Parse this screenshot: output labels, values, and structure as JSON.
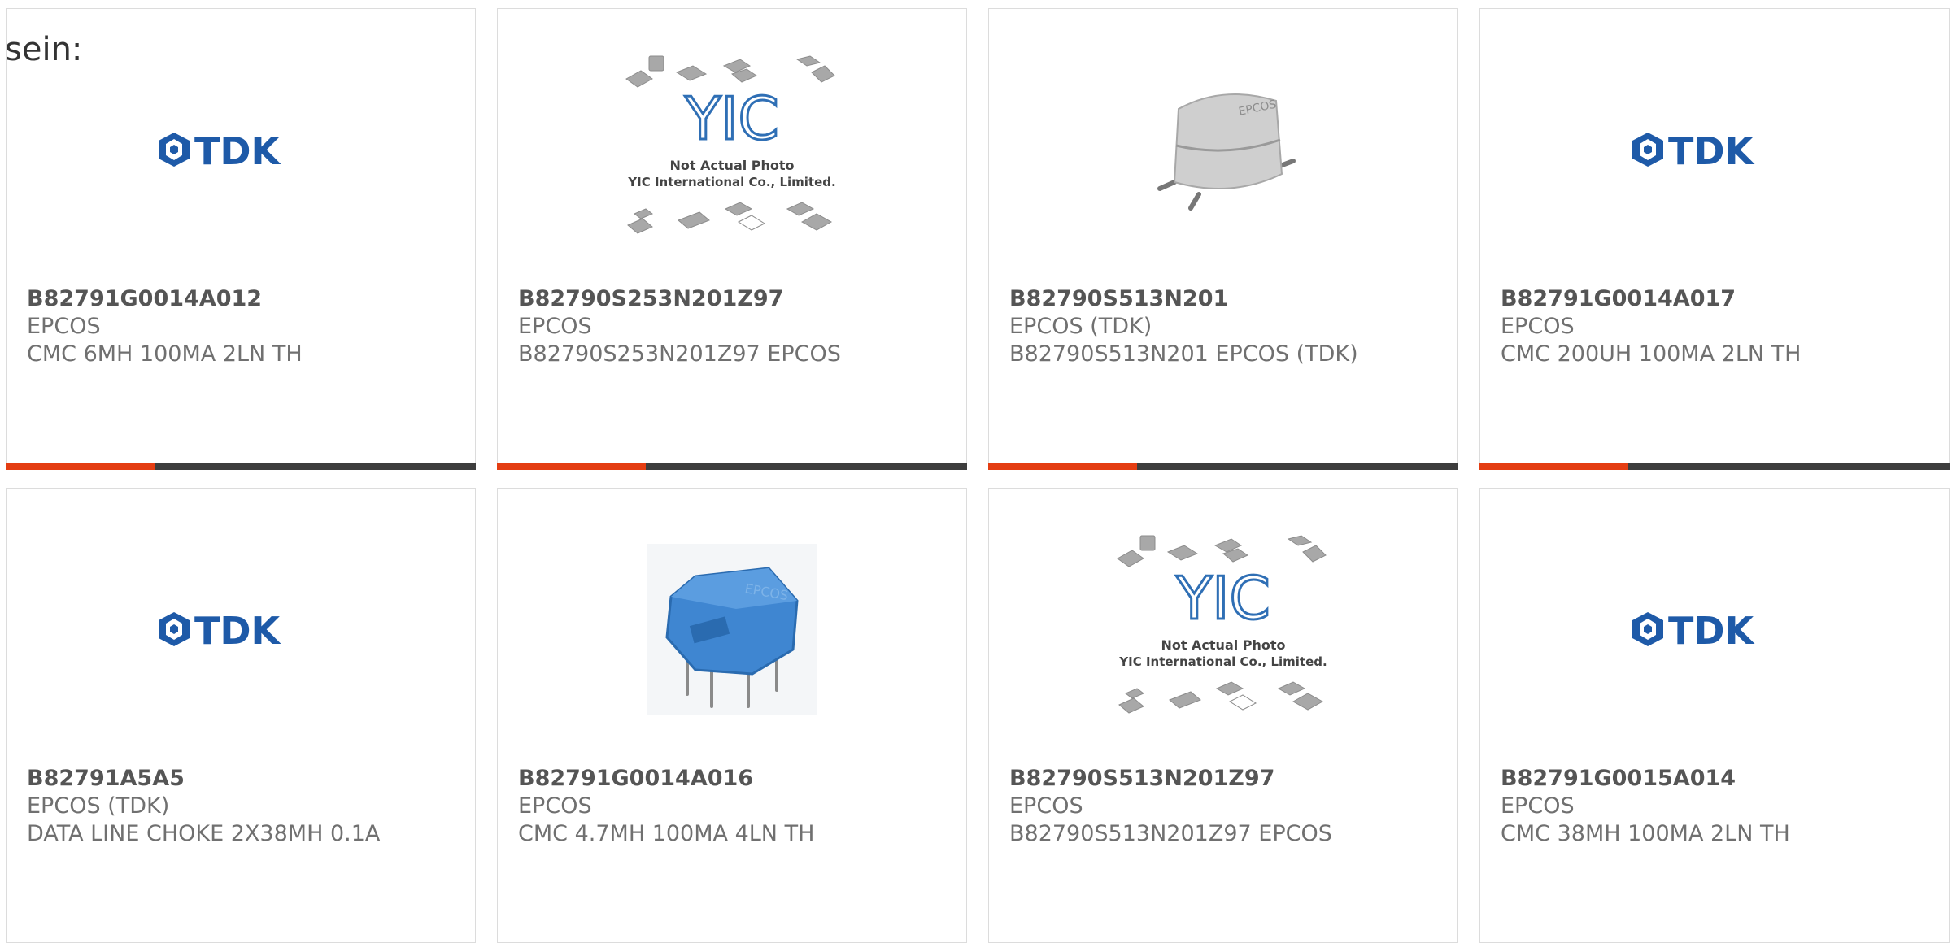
{
  "intro_text": "sein:",
  "products": [
    {
      "part": "B82791G0014A012",
      "manufacturer": "EPCOS",
      "description": "CMC 6MH 100MA 2LN TH",
      "image": "tdk-logo"
    },
    {
      "part": "B82790S253N201Z97",
      "manufacturer": "EPCOS",
      "description": "B82790S253N201Z97 EPCOS",
      "image": "yic-placeholder"
    },
    {
      "part": "B82790S513N201",
      "manufacturer": "EPCOS (TDK)",
      "description": "B82790S513N201 EPCOS (TDK)",
      "image": "gray-choke-photo"
    },
    {
      "part": "B82791G0014A017",
      "manufacturer": "EPCOS",
      "description": "CMC 200UH 100MA 2LN TH",
      "image": "tdk-logo"
    },
    {
      "part": "B82791A5A5",
      "manufacturer": "EPCOS (TDK)",
      "description": "DATA LINE CHOKE 2X38MH 0.1A",
      "image": "tdk-logo"
    },
    {
      "part": "B82791G0014A016",
      "manufacturer": "EPCOS",
      "description": "CMC 4.7MH 100MA 4LN TH",
      "image": "blue-choke-photo"
    },
    {
      "part": "B82790S513N201Z97",
      "manufacturer": "EPCOS",
      "description": "B82790S513N201Z97 EPCOS",
      "image": "yic-placeholder"
    },
    {
      "part": "B82791G0015A014",
      "manufacturer": "EPCOS",
      "description": "CMC 38MH 100MA 2LN TH",
      "image": "tdk-logo"
    }
  ],
  "logo": {
    "brand": "TDK",
    "color": "#1e5aa8"
  },
  "placeholder": {
    "line1": "Not Actual Photo",
    "line2": "YIC International Co., Limited.",
    "mark": "YIC"
  },
  "component_marking": {
    "gray": "EPCOS",
    "blue": "EPCOS"
  },
  "colors": {
    "accent": "#e43d12",
    "bar": "#3d3d3d",
    "border": "#dcdcdc"
  }
}
